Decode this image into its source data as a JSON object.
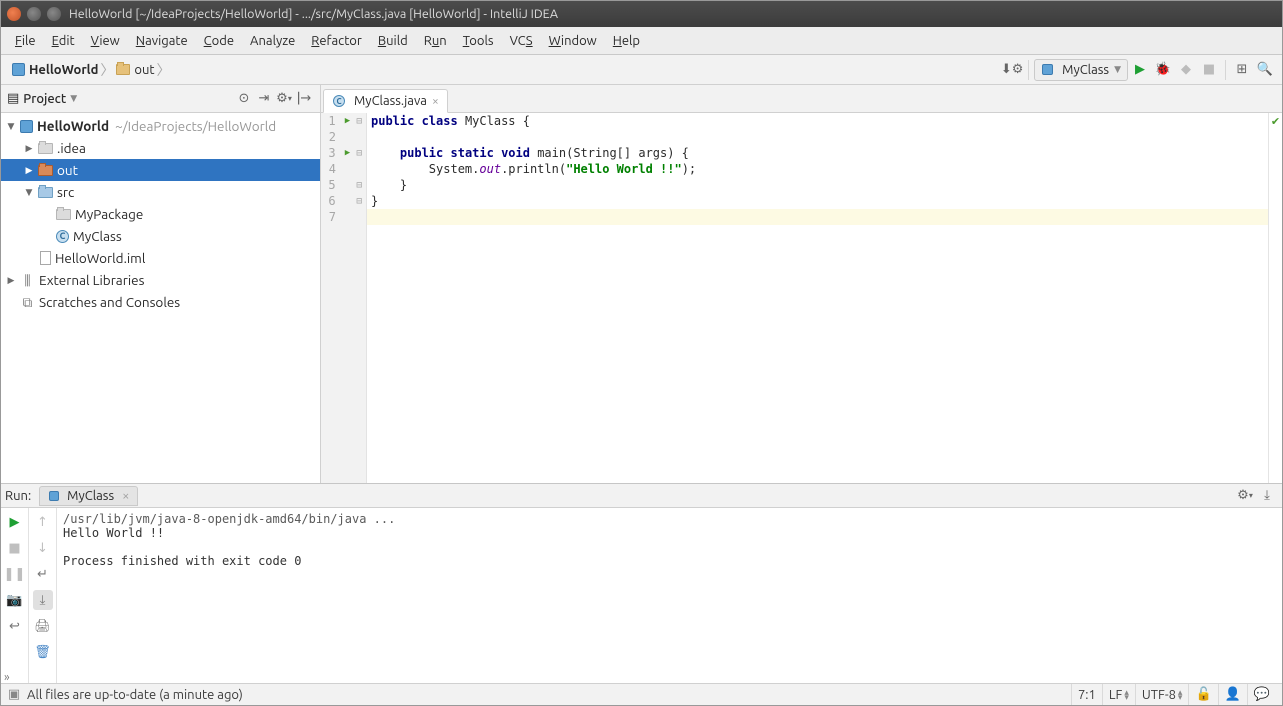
{
  "window": {
    "title": "HelloWorld [~/IdeaProjects/HelloWorld] - .../src/MyClass.java [HelloWorld] - IntelliJ IDEA"
  },
  "menubar": {
    "file": "File",
    "edit": "Edit",
    "view": "View",
    "navigate": "Navigate",
    "code": "Code",
    "analyze": "Analyze",
    "refactor": "Refactor",
    "build": "Build",
    "run": "Run",
    "tools": "Tools",
    "vcs": "VCS",
    "window": "Window",
    "help": "Help"
  },
  "breadcrumb": {
    "root": "HelloWorld",
    "leaf": "out"
  },
  "toolbar": {
    "run_config": "MyClass"
  },
  "project_pane": {
    "title": "Project",
    "tree": {
      "root": "HelloWorld",
      "root_path": "~/IdeaProjects/HelloWorld",
      "idea": ".idea",
      "out": "out",
      "src": "src",
      "pkg": "MyPackage",
      "cls": "MyClass",
      "iml": "HelloWorld.iml",
      "ext": "External Libraries",
      "scratch": "Scratches and Consoles"
    }
  },
  "editor": {
    "tab": "MyClass.java",
    "lines": [
      "1",
      "2",
      "3",
      "4",
      "5",
      "6",
      "7"
    ],
    "code": {
      "l1_pre": "public",
      "l1_mid": " class",
      "l1_rest": " MyClass {",
      "l3_a": "public",
      "l3_b": " static",
      "l3_c": " void",
      "l3_rest": " main(String[] args) {",
      "l4_a": "        System.",
      "l4_out": "out",
      "l4_b": ".println(",
      "l4_str": "\"Hello World !!\"",
      "l4_c": ");",
      "l5": "    }",
      "l6": "}"
    }
  },
  "run": {
    "header": "Run:",
    "tab": "MyClass",
    "cmd": "/usr/lib/jvm/java-8-openjdk-amd64/bin/java ...",
    "out1": "Hello World !!",
    "out2": "Process finished with exit code 0",
    "hide": "»"
  },
  "status": {
    "msg": "All files are up-to-date (a minute ago)",
    "pos": "7:1",
    "sep": "LF",
    "enc": "UTF-8"
  }
}
